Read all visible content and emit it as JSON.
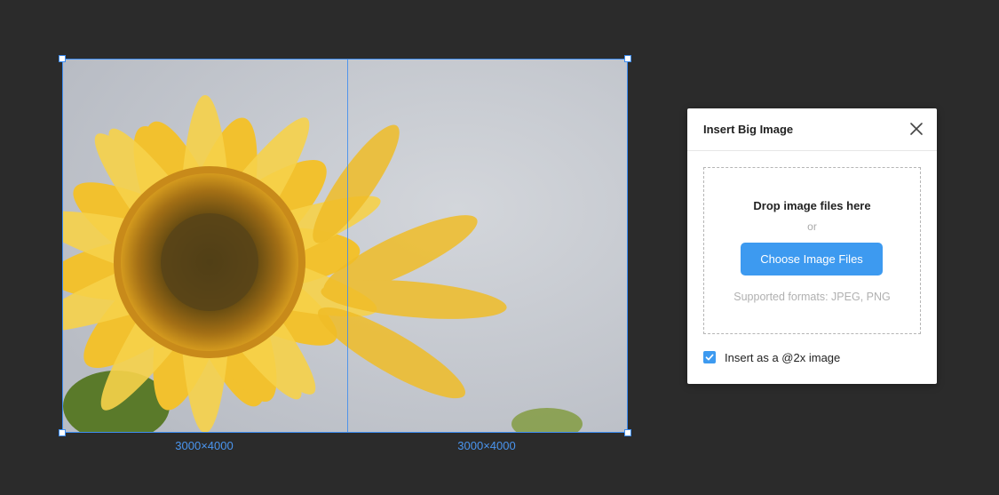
{
  "canvas": {
    "tiles": [
      {
        "dimensions": "3000×4000"
      },
      {
        "dimensions": "3000×4000"
      }
    ],
    "image_subject": "sunflower"
  },
  "dialog": {
    "title": "Insert Big Image",
    "drop_title": "Drop image files here",
    "drop_or": "or",
    "choose_button": "Choose Image Files",
    "formats": "Supported formats: JPEG, PNG",
    "option_label": "Insert as a @2x image",
    "option_checked": true
  },
  "colors": {
    "background": "#2b2b2b",
    "selection": "#3d8cf0",
    "accent": "#3d9af0"
  },
  "icons": {
    "close": "close-icon",
    "check": "check-icon"
  }
}
